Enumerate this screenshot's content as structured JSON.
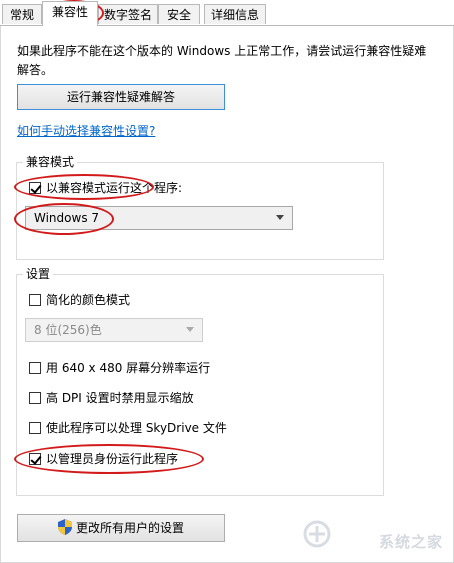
{
  "tabs": [
    {
      "label": "常规",
      "active": false
    },
    {
      "label": "兼容性",
      "active": true
    },
    {
      "label": "数字签名",
      "active": false
    },
    {
      "label": "安全",
      "active": false
    },
    {
      "label": "详细信息",
      "active": false
    }
  ],
  "description": "如果此程序不能在这个版本的 Windows 上正常工作，请尝试运行兼容性疑难解答。",
  "troubleshoot_button": "运行兼容性疑难解答",
  "manual_link": "如何手动选择兼容性设置?",
  "compat_mode": {
    "group_label": "兼容模式",
    "run_in_compat_label": "以兼容模式运行这个程序:",
    "run_in_compat_checked": true,
    "os_selected": "Windows 7"
  },
  "settings": {
    "group_label": "设置",
    "reduced_color_label": "简化的颜色模式",
    "reduced_color_checked": false,
    "color_depth_selected": "8 位(256)色",
    "res_640_label": "用 640 x 480 屏幕分辨率运行",
    "res_640_checked": false,
    "dpi_label": "高 DPI 设置时禁用显示缩放",
    "dpi_checked": false,
    "skydrive_label": "使此程序可以处理 SkyDrive 文件",
    "skydrive_checked": false,
    "admin_label": "以管理员身份运行此程序",
    "admin_checked": true
  },
  "all_users_button": "更改所有用户的设置",
  "watermark": "系统之家",
  "colors": {
    "annotation_red": "#d21a1a",
    "link_blue": "#0066cc"
  }
}
